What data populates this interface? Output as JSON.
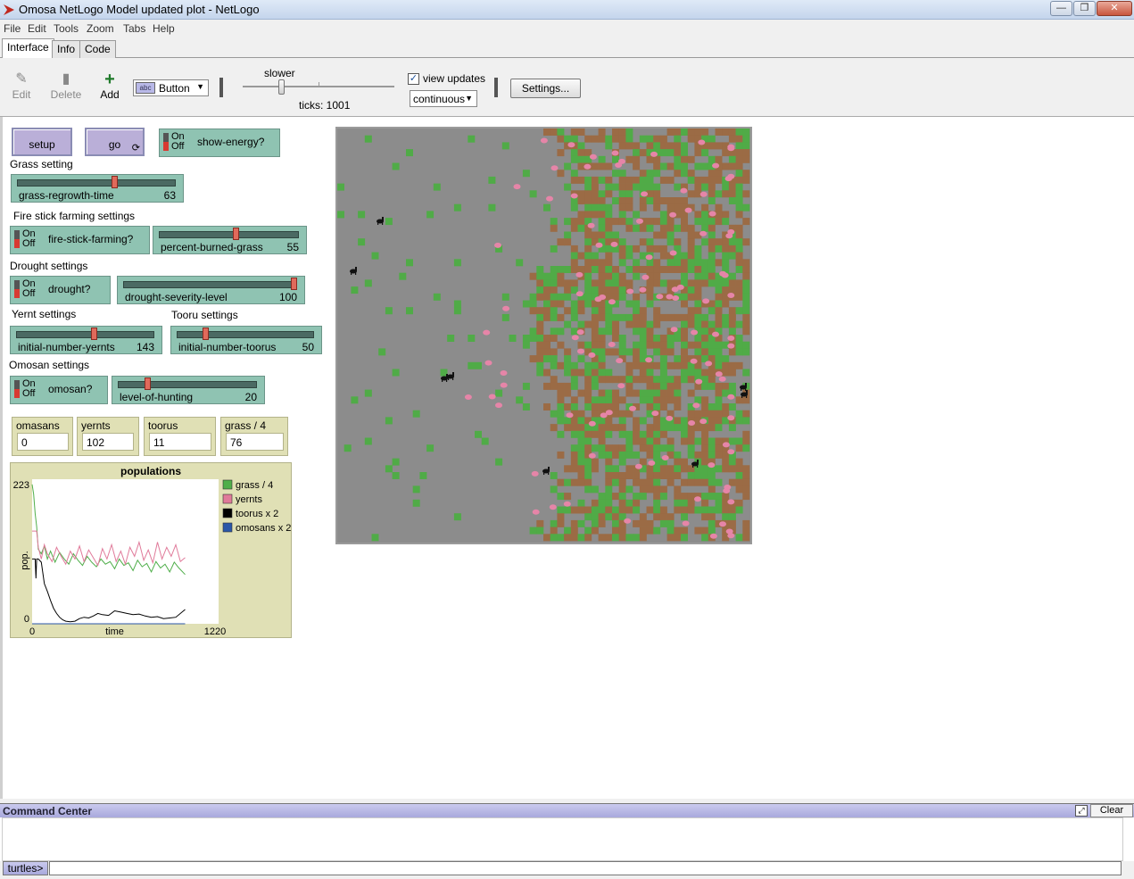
{
  "window": {
    "title": "Omosa NetLogo Model updated plot - NetLogo"
  },
  "menu": [
    "File",
    "Edit",
    "Tools",
    "Zoom",
    "Tabs",
    "Help"
  ],
  "tabs": [
    {
      "label": "Interface",
      "active": true
    },
    {
      "label": "Info"
    },
    {
      "label": "Code"
    }
  ],
  "toolbar": {
    "edit": "Edit",
    "delete": "Delete",
    "add": "Add",
    "widget_type": "Button",
    "speed_label": "slower",
    "ticks": "ticks: 1001",
    "view_updates_label": "view updates",
    "view_updates_checked": true,
    "update_mode": "continuous",
    "settings": "Settings..."
  },
  "buttons": {
    "setup": "setup",
    "go": "go"
  },
  "switches": {
    "show_energy": {
      "label": "show-energy?",
      "on": "On",
      "off": "Off"
    },
    "fire_stick": {
      "label": "fire-stick-farming?",
      "on": "On",
      "off": "Off"
    },
    "drought": {
      "label": "drought?",
      "on": "On",
      "off": "Off"
    },
    "omosan": {
      "label": "omosan?",
      "on": "On",
      "off": "Off"
    }
  },
  "notes": {
    "grass": "Grass setting",
    "fire": "Fire stick farming settings",
    "drought": "Drought settings",
    "yernt": "Yernt settings",
    "tooru": "Tooru settings",
    "omosan": "Omosan settings"
  },
  "sliders": {
    "grass_regrowth": {
      "name": "grass-regrowth-time",
      "value": "63",
      "fraction": 0.62
    },
    "percent_burned": {
      "name": "percent-burned-grass",
      "value": "55",
      "fraction": 0.55
    },
    "drought_severity": {
      "name": "drought-severity-level",
      "value": "100",
      "fraction": 1.0
    },
    "initial_yernts": {
      "name": "initial-number-yernts",
      "value": "143",
      "fraction": 0.57
    },
    "initial_toorus": {
      "name": "initial-number-toorus",
      "value": "50",
      "fraction": 0.2
    },
    "level_hunting": {
      "name": "level-of-hunting",
      "value": "20",
      "fraction": 0.2
    }
  },
  "monitors": [
    {
      "label": "omasans",
      "value": "0"
    },
    {
      "label": "yernts",
      "value": "102"
    },
    {
      "label": "toorus",
      "value": "11"
    },
    {
      "label": "grass / 4",
      "value": "76"
    }
  ],
  "chart_data": {
    "type": "line",
    "title": "populations",
    "xlabel": "time",
    "ylabel": "pop.",
    "xlim": [
      0,
      1220
    ],
    "ylim": [
      0,
      223
    ],
    "x_tick_labels": [
      "0",
      "1220"
    ],
    "y_tick_labels": [
      "0",
      "223"
    ],
    "legend_position": "right",
    "series": [
      {
        "name": "grass / 4",
        "color": "#4fae4a",
        "x": [
          0,
          10,
          20,
          30,
          40,
          60,
          80,
          100,
          120,
          150,
          180,
          210,
          240,
          270,
          300,
          330,
          360,
          390,
          420,
          450,
          480,
          510,
          540,
          570,
          600,
          630,
          660,
          690,
          720,
          750,
          780,
          810,
          840,
          870,
          900,
          930,
          960,
          1001
        ],
        "y": [
          215,
          200,
          170,
          150,
          115,
          108,
          120,
          100,
          112,
          95,
          110,
          100,
          92,
          108,
          98,
          90,
          104,
          95,
          88,
          100,
          92,
          96,
          85,
          100,
          90,
          94,
          82,
          98,
          88,
          93,
          80,
          96,
          86,
          92,
          80,
          95,
          86,
          76
        ]
      },
      {
        "name": "yernts",
        "color": "#e07a9a",
        "x": [
          0,
          20,
          30,
          40,
          60,
          80,
          100,
          130,
          160,
          190,
          220,
          250,
          280,
          310,
          340,
          370,
          400,
          430,
          460,
          490,
          520,
          550,
          580,
          610,
          640,
          670,
          700,
          730,
          760,
          790,
          820,
          850,
          880,
          910,
          940,
          970,
          1001
        ],
        "y": [
          143,
          143,
          143,
          118,
          100,
          122,
          108,
          96,
          118,
          104,
          92,
          112,
          100,
          120,
          96,
          114,
          102,
          90,
          116,
          100,
          122,
          96,
          112,
          92,
          118,
          104,
          126,
          98,
          114,
          94,
          126,
          100,
          118,
          104,
          122,
          96,
          102
        ]
      },
      {
        "name": "toorus x 2",
        "color": "#000000",
        "x": [
          0,
          10,
          20,
          25,
          30,
          40,
          60,
          80,
          100,
          120,
          140,
          160,
          180,
          200,
          220,
          250,
          280,
          310,
          340,
          370,
          400,
          430,
          460,
          500,
          540,
          580,
          620,
          660,
          700,
          740,
          780,
          820,
          860,
          900,
          940,
          1001
        ],
        "y": [
          100,
          100,
          100,
          70,
          100,
          100,
          95,
          62,
          50,
          36,
          24,
          16,
          10,
          6,
          4,
          3,
          4,
          8,
          10,
          9,
          12,
          16,
          14,
          13,
          20,
          18,
          16,
          14,
          15,
          12,
          10,
          11,
          8,
          9,
          10,
          22
        ]
      },
      {
        "name": "omosans x 2",
        "color": "#2a56a8",
        "x": [
          0,
          1001
        ],
        "y": [
          0,
          0
        ]
      }
    ]
  },
  "world": {
    "background": "#8c8c8c",
    "grass_color": "#50ab47",
    "burnt_color": "#9b6b45",
    "yernt_color": "#e685a8",
    "tooru_color": "#111111"
  },
  "command_center": {
    "title": "Command Center",
    "clear": "Clear",
    "agent": "turtles>"
  }
}
